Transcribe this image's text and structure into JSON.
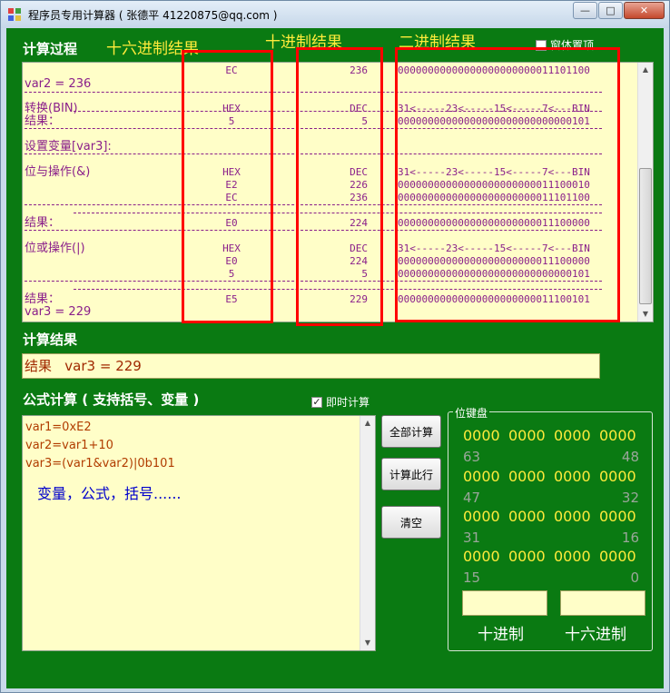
{
  "window": {
    "title": "程序员专用计算器 ( 张德平 41220875@qq.com )",
    "min_glyph": "—",
    "max_glyph": "□",
    "close_glyph": "✕"
  },
  "overlays": {
    "hex_result": "十六进制结果",
    "dec_result": "十进制结果",
    "bin_result": "二进制结果"
  },
  "process": {
    "label": "计算过程",
    "pin_checkbox_label": "窗体置顶",
    "pin_checked": false,
    "rows": [
      {
        "label": "",
        "hex": "EC",
        "dec": "236",
        "bin": "00000000000000000000000011101100"
      },
      {
        "label": "var2 = 236"
      },
      {
        "label": "转换(BIN)",
        "hex": "HEX",
        "dec": "DEC",
        "bin": "31<-----23<-----15<-----7<---BIN"
      },
      {
        "label": "结果：",
        "hex": "5",
        "dec": "5",
        "bin": "00000000000000000000000000000101"
      },
      {
        "label": "设置变量[var3]:"
      },
      {
        "label": "位与操作(&)",
        "hex": "HEX",
        "dec": "DEC",
        "bin": "31<-----23<-----15<-----7<---BIN"
      },
      {
        "hex": "E2",
        "dec": "226",
        "bin": "00000000000000000000000011100010"
      },
      {
        "hex": "EC",
        "dec": "236",
        "bin": "00000000000000000000000011101100"
      },
      {
        "label": "结果：",
        "hex": "E0",
        "dec": "224",
        "bin": "00000000000000000000000011100000"
      },
      {
        "label": "位或操作(|)",
        "hex": "HEX",
        "dec": "DEC",
        "bin": "31<-----23<-----15<-----7<---BIN"
      },
      {
        "hex": "E0",
        "dec": "224",
        "bin": "00000000000000000000000011100000"
      },
      {
        "hex": "5",
        "dec": "5",
        "bin": "00000000000000000000000000000101"
      },
      {
        "label": "结果：",
        "hex": "E5",
        "dec": "229",
        "bin": "00000000000000000000000011100101"
      },
      {
        "label": "var3 = 229"
      }
    ]
  },
  "result": {
    "label": "计算结果",
    "text": "结果   var3 = 229"
  },
  "formula": {
    "label": "公式计算 ( 支持括号、变量 )",
    "instant_label": "即时计算",
    "instant_checked": true,
    "lines": [
      "var1=0xE2",
      "var2=var1+10",
      "var3=(var1&var2)|0b101"
    ],
    "hint": "变量，公式，括号......"
  },
  "buttons": {
    "calc_all": "全部计算",
    "calc_line": "计算此行",
    "clear": "清空"
  },
  "bitpad": {
    "title": "位键盘",
    "rows": [
      [
        "0000",
        "0000",
        "0000",
        "0000"
      ],
      [
        "0000",
        "0000",
        "0000",
        "0000"
      ],
      [
        "0000",
        "0000",
        "0000",
        "0000"
      ],
      [
        "0000",
        "0000",
        "0000",
        "0000"
      ]
    ],
    "indices": [
      [
        "63",
        "48"
      ],
      [
        "47",
        "32"
      ],
      [
        "31",
        "16"
      ],
      [
        "15",
        "0"
      ]
    ],
    "dec_label": "十进制",
    "hex_label": "十六进制"
  }
}
